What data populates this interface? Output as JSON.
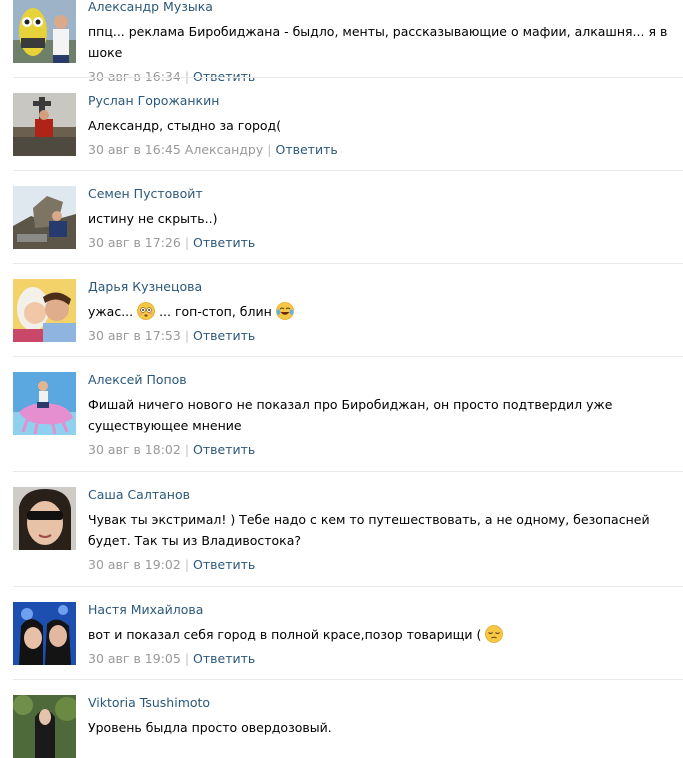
{
  "comments": [
    {
      "author": "Александр Музыка",
      "text_parts": [
        "ппц... реклама Биробиджана - быдло, менты, рассказывающие о мафии, алкашня... я в шоке"
      ],
      "date": "30 авг в 16:34",
      "reply_to": "",
      "reply_label": "Ответить",
      "avatar": "yellow-mascot-photo"
    },
    {
      "author": "Руслан Горожанкин",
      "text_parts": [
        "Александр, стыдно за город("
      ],
      "date": "30 авг в 16:45",
      "reply_to": "Александру",
      "reply_label": "Ответить",
      "avatar": "man-at-monument-photo"
    },
    {
      "author": "Семен Пустовойт",
      "text_parts": [
        "истину не скрыть..)"
      ],
      "date": "30 авг в 17:26",
      "reply_to": "",
      "reply_label": "Ответить",
      "avatar": "man-on-rocks-photo"
    },
    {
      "author": "Дарья Кузнецова",
      "text_parts": [
        "ужас... ",
        " ... гоп-стоп, блин "
      ],
      "emojis": [
        "flushed-emoji",
        "crying-laughing-emoji"
      ],
      "date": "30 авг в 17:53",
      "reply_to": "",
      "reply_label": "Ответить",
      "avatar": "couple-selfie-photo"
    },
    {
      "author": "Алексей Попов",
      "text_parts": [
        "Фишай ничего нового не показал про Биробиджан, он просто подтвердил уже существующее мнение"
      ],
      "date": "30 авг в 18:02",
      "reply_to": "",
      "reply_label": "Ответить",
      "avatar": "rider-on-pink-creature-picture"
    },
    {
      "author": "Саша Салтанов",
      "text_parts": [
        "Чувак ты экстримал! ) Тебе надо с кем то путешествовать, а не одному, безопасней будет. Так ты из Владивостока?"
      ],
      "date": "30 авг в 19:02",
      "reply_to": "",
      "reply_label": "Ответить",
      "avatar": "woman-sunglasses-photo"
    },
    {
      "author": "Настя Михайлова",
      "text_parts": [
        "вот и показал себя город в полной красе,позор товарищи ( "
      ],
      "emojis": [
        "pensive-emoji"
      ],
      "date": "30 авг в 19:05",
      "reply_to": "",
      "reply_label": "Ответить",
      "avatar": "two-girls-blue-photo"
    },
    {
      "author": "Viktoria Tsushimoto",
      "text_parts": [
        "Уровень быдла просто овердозовый."
      ],
      "date": "",
      "reply_to": "",
      "reply_label": "",
      "avatar": "girl-in-garden-photo"
    }
  ]
}
